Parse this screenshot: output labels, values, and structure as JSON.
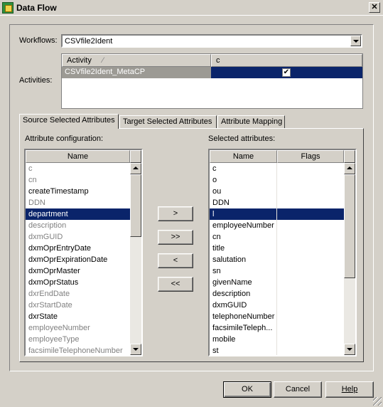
{
  "window": {
    "title": "Data Flow"
  },
  "workflows": {
    "label": "Workflows:",
    "value": "CSVfile2Ident"
  },
  "activities": {
    "label": "Activities:",
    "columns": [
      "Activity",
      "c"
    ],
    "rows": [
      {
        "name": "CSVfile2Ident_MetaCP",
        "checked": true,
        "check_glyph": "✔"
      }
    ]
  },
  "tabs": [
    "Source Selected Attributes",
    "Target Selected Attributes",
    "Attribute Mapping"
  ],
  "active_tab": 0,
  "attribute_config": {
    "label": "Attribute configuration:",
    "header": "Name",
    "items": [
      {
        "text": "c",
        "grey": true
      },
      {
        "text": "cn",
        "grey": true
      },
      {
        "text": "createTimestamp",
        "grey": false
      },
      {
        "text": "DDN",
        "grey": true
      },
      {
        "text": "department",
        "grey": false,
        "selected": true
      },
      {
        "text": "description",
        "grey": true
      },
      {
        "text": "dxmGUID",
        "grey": true
      },
      {
        "text": "dxmOprEntryDate",
        "grey": false
      },
      {
        "text": "dxmOprExpirationDate",
        "grey": false
      },
      {
        "text": "dxmOprMaster",
        "grey": false
      },
      {
        "text": "dxmOprStatus",
        "grey": false
      },
      {
        "text": "dxrEndDate",
        "grey": true
      },
      {
        "text": "dxrStartDate",
        "grey": true
      },
      {
        "text": "dxrState",
        "grey": false
      },
      {
        "text": "employeeNumber",
        "grey": true
      },
      {
        "text": "employeeType",
        "grey": true
      },
      {
        "text": "facsimileTelephoneNumber",
        "grey": true
      }
    ]
  },
  "transfer_buttons": [
    ">",
    ">>",
    "<",
    "<<"
  ],
  "selected_attributes": {
    "label": "Selected attributes:",
    "headers": [
      "Name",
      "Flags"
    ],
    "items": [
      {
        "name": "c"
      },
      {
        "name": "o"
      },
      {
        "name": "ou"
      },
      {
        "name": "DDN"
      },
      {
        "name": "l",
        "selected": true
      },
      {
        "name": "employeeNumber"
      },
      {
        "name": "cn"
      },
      {
        "name": "title"
      },
      {
        "name": "salutation"
      },
      {
        "name": "sn"
      },
      {
        "name": "givenName"
      },
      {
        "name": "description"
      },
      {
        "name": "dxmGUID"
      },
      {
        "name": "telephoneNumber"
      },
      {
        "name": "facsimileTeleph..."
      },
      {
        "name": "mobile"
      },
      {
        "name": "st"
      }
    ]
  },
  "buttons": {
    "ok": "OK",
    "cancel": "Cancel",
    "help": "Help"
  },
  "colors": {
    "selection": "#0a246a",
    "face": "#d4d0c8",
    "disabled_text": "#808080"
  }
}
